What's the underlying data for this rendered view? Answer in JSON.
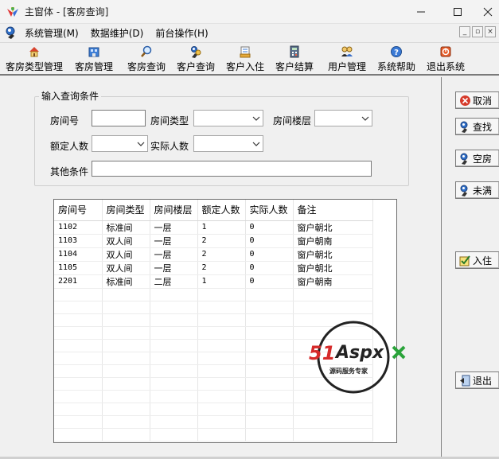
{
  "window": {
    "title": "主窗体 - [客房查询]",
    "controls": {
      "minimize": "—",
      "maximize": "□",
      "close": "✕"
    }
  },
  "menubar": {
    "items": [
      {
        "label": "系统管理(M)"
      },
      {
        "label": "数据维护(D)"
      },
      {
        "label": "前台操作(H)"
      }
    ],
    "mdi": {
      "minimize": "_",
      "restore": "▫",
      "close": "×"
    }
  },
  "toolbar": {
    "buttons": [
      {
        "label": "客房类型管理",
        "icon": "house-icon"
      },
      {
        "label": "客房管理",
        "icon": "room-icon"
      },
      {
        "label": "客房查询",
        "icon": "magnifier-icon"
      },
      {
        "label": "客户查询",
        "icon": "people-search-icon"
      },
      {
        "label": "客户入住",
        "icon": "checkin-icon"
      },
      {
        "label": "客户结算",
        "icon": "calculator-icon"
      },
      {
        "label": "用户管理",
        "icon": "users-icon"
      },
      {
        "label": "系统帮助",
        "icon": "help-icon"
      },
      {
        "label": "退出系统",
        "icon": "exit-icon"
      }
    ]
  },
  "query": {
    "group_title": "输入查询条件",
    "room_no_label": "房间号",
    "room_no_value": "",
    "room_type_label": "房间类型",
    "room_type_value": "",
    "floor_label": "房间楼层",
    "floor_value": "",
    "capacity_label": "额定人数",
    "capacity_value": "",
    "actual_label": "实际人数",
    "actual_value": "",
    "other_label": "其他条件",
    "other_value": ""
  },
  "grid": {
    "columns": [
      "房间号",
      "房间类型",
      "房间楼层",
      "额定人数",
      "实际人数",
      "备注"
    ],
    "rows": [
      [
        "1102",
        "标准间",
        "一层",
        "1",
        "0",
        "窗户朝北"
      ],
      [
        "1103",
        "双人间",
        "一层",
        "2",
        "0",
        "窗户朝南"
      ],
      [
        "1104",
        "双人间",
        "一层",
        "2",
        "0",
        "窗户朝北"
      ],
      [
        "1105",
        "双人间",
        "一层",
        "2",
        "0",
        "窗户朝北"
      ],
      [
        "2201",
        "标准间",
        "二层",
        "1",
        "0",
        "窗户朝南"
      ]
    ]
  },
  "actions": {
    "cancel": "取消",
    "search": "查找",
    "vacant": "空房",
    "not_full": "未满",
    "checkin": "入住",
    "exit": "退出"
  },
  "watermark": {
    "brand_51": "51",
    "brand_aspx": "Aspx",
    "tagline": "源码服务专家"
  },
  "colors": {
    "watermark_red": "#d62a2a",
    "watermark_green": "#2aa33a",
    "window_bg": "#f0f0f0"
  }
}
